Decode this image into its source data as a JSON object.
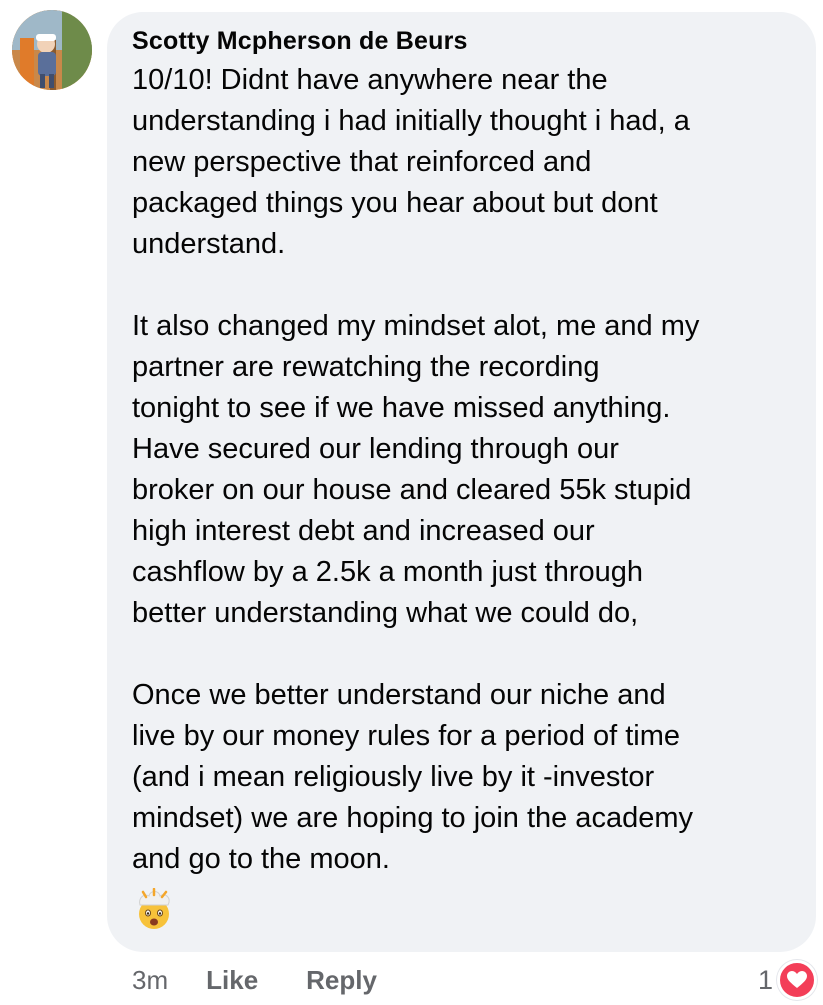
{
  "comment": {
    "author": "Scotty Mcpherson de Beurs",
    "paragraphs": [
      "10/10! Didnt have anywhere near the\nunderstanding i had initially thought i had, a\nnew perspective that reinforced and\npackaged things you hear about but dont\nunderstand.",
      "It also changed my mindset alot, me and my\npartner are rewatching the recording\ntonight to see if we have missed anything.\nHave secured our lending through our\nbroker on our house and cleared 55k stupid\nhigh interest debt and increased our\ncashflow by a 2.5k a month just through\nbetter understanding what we could do,",
      "Once we better understand our niche and\nlive by our money rules for a period of time\n(and i mean religiously live by it -investor\nmindset) we are hoping to join the academy\nand go to the moon."
    ],
    "emoji_icon": "exploding-head-emoji"
  },
  "actions": {
    "time": "3m",
    "like_label": "Like",
    "reply_label": "Reply"
  },
  "reactions": {
    "count": "1",
    "icon": "heart-icon",
    "badge_color": "#f33e58"
  },
  "colors": {
    "bubble": "#f0f2f5",
    "secondary_text": "#65676b"
  }
}
